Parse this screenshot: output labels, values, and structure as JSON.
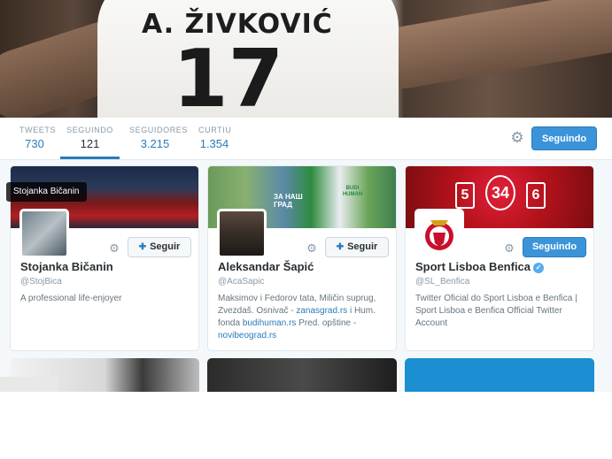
{
  "banner": {
    "shirt_name": "A. ŽIVKOVIĆ",
    "shirt_number": "17"
  },
  "nav": {
    "items": [
      {
        "label": "TWEETS",
        "value": "730"
      },
      {
        "label": "SEGUINDO",
        "value": "121"
      },
      {
        "label": "SEGUIDORES",
        "value": "3.215"
      },
      {
        "label": "CURTIU",
        "value": "1.354"
      }
    ],
    "follow_label": "Seguindo"
  },
  "tooltip": "Stojanka Bičanin",
  "cards": [
    {
      "name": "Stojanka Bičanin",
      "handle": "@StojBica",
      "bio": "A professional life-enjoyer",
      "follow_label": "Seguir"
    },
    {
      "name": "Aleksandar Šapić",
      "handle": "@AcaSapic",
      "bio_parts": {
        "p1": "Maksimov i Fedorov tata, Miličin suprug, Zvezdaš. Osnivač - ",
        "link1": "zanasgrad.rs",
        "p2": " i Hum. fonda ",
        "link2": "budihuman.rs",
        "p3": " Pred. opštine - ",
        "link3": "novibeograd.rs"
      },
      "follow_label": "Seguir",
      "banner_text": "ЗА НАШ ГРАД",
      "banner_logo": "BUDI HUMAN"
    },
    {
      "name": "Sport Lisboa Benfica",
      "handle": "@SL_Benfica",
      "bio": "Twitter Oficial do Sport Lisboa e Benfica | Sport Lisboa e Benfica Official Twitter Account",
      "follow_label": "Seguindo",
      "banner_numbers": [
        "5",
        "34",
        "6"
      ]
    }
  ],
  "colors": {
    "accent": "#2b7bb9",
    "follow_button": "#3b94d9",
    "benfica_red": "#c8102e"
  }
}
